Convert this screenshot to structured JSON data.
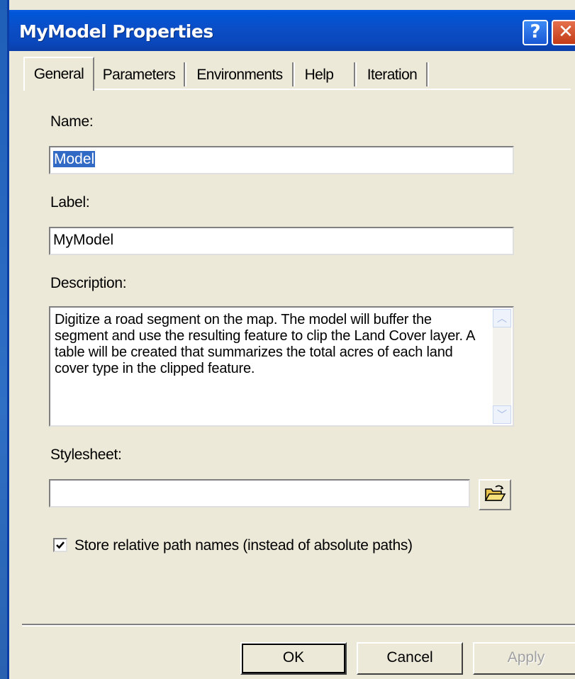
{
  "window": {
    "title": "MyModel Properties",
    "help_button": "?",
    "close_button": "✕"
  },
  "tabs": [
    {
      "label": "General",
      "active": true
    },
    {
      "label": "Parameters",
      "active": false
    },
    {
      "label": "Environments",
      "active": false
    },
    {
      "label": "Help",
      "active": false
    },
    {
      "label": "Iteration",
      "active": false
    }
  ],
  "form": {
    "name_label": "Name:",
    "name_value": "Model",
    "label_label": "Label:",
    "label_value": "MyModel",
    "description_label": "Description:",
    "description_value": "Digitize a road segment on the map. The model will buffer the segment and use the resulting feature to clip the Land Cover layer. A table will be created that summarizes the total acres of each land cover type in the clipped feature.",
    "stylesheet_label": "Stylesheet:",
    "stylesheet_value": "",
    "relative_paths_label": "Store relative path names (instead of absolute paths)",
    "relative_paths_checked": true
  },
  "icons": {
    "browse_folder": "folder-open-icon",
    "scroll_up": "scroll-up-arrow-icon",
    "scroll_down": "scroll-down-arrow-icon",
    "checkmark": "checkmark-icon"
  },
  "buttons": {
    "ok": "OK",
    "cancel": "Cancel",
    "apply": "Apply"
  },
  "colors": {
    "titlebar": "#0a47bc",
    "dialog_bg": "#ece9d8",
    "selection": "#316ac5",
    "close": "#c23b16"
  }
}
